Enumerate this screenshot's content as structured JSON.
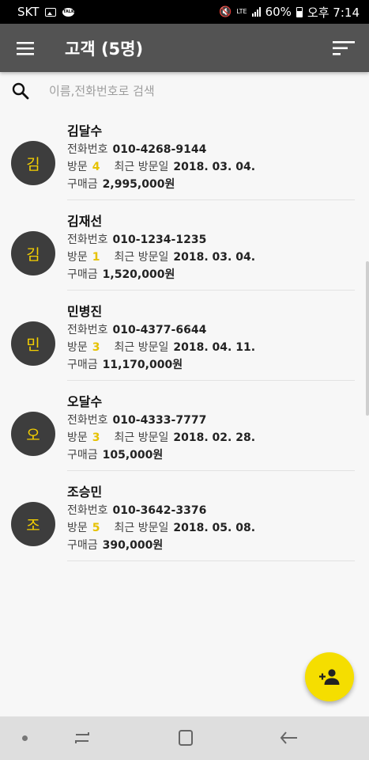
{
  "status_bar": {
    "carrier": "SKT",
    "network": "LTE",
    "battery": "60%",
    "time": "오후 7:14"
  },
  "app_bar": {
    "title": "고객 (5명)"
  },
  "search": {
    "placeholder": "이름,전화번호로 검색",
    "value": ""
  },
  "labels": {
    "phone": "전화번호",
    "visits": "방문",
    "recent_visit": "최근 방문일",
    "purchase": "구매금"
  },
  "customers": [
    {
      "initial": "김",
      "name": "김달수",
      "phone": "010-4268-9144",
      "visits": "4",
      "recent": "2018. 03. 04.",
      "purchase": "2,995,000원"
    },
    {
      "initial": "김",
      "name": "김재선",
      "phone": "010-1234-1235",
      "visits": "1",
      "recent": "2018. 03. 04.",
      "purchase": "1,520,000원"
    },
    {
      "initial": "민",
      "name": "민병진",
      "phone": "010-4377-6644",
      "visits": "3",
      "recent": "2018. 04. 11.",
      "purchase": "11,170,000원"
    },
    {
      "initial": "오",
      "name": "오달수",
      "phone": "010-4333-7777",
      "visits": "3",
      "recent": "2018. 02. 28.",
      "purchase": "105,000원"
    },
    {
      "initial": "조",
      "name": "조승민",
      "phone": "010-3642-3376",
      "visits": "5",
      "recent": "2018. 05. 08.",
      "purchase": "390,000원"
    }
  ],
  "colors": {
    "app_bar": "#535353",
    "accent": "#f5de00",
    "avatar_bg": "#3d3d3d",
    "avatar_text": "#f5d000"
  },
  "icons": {
    "menu": "hamburger-menu-icon",
    "sort": "sort-icon",
    "search": "search-icon",
    "fab": "add-person-icon"
  }
}
